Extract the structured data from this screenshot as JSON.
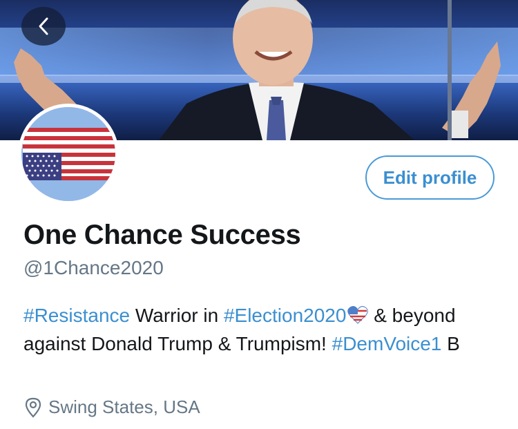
{
  "header": {
    "back_icon": "chevron-left-icon"
  },
  "profile": {
    "display_name": "One Chance Success",
    "handle": "@1Chance2020",
    "edit_label": "Edit profile",
    "bio": {
      "tag1": "#Resistance",
      "text1": " Warrior in ",
      "tag2": "#Election2020",
      "text2": " & beyond against Donald Trump & Trumpism! ",
      "tag3": "#DemVoice1",
      "text3": " B"
    },
    "location": "Swing States, USA",
    "location_icon": "map-pin-icon"
  },
  "colors": {
    "link": "#3b8fd0",
    "muted": "#657786",
    "text": "#14171a"
  }
}
